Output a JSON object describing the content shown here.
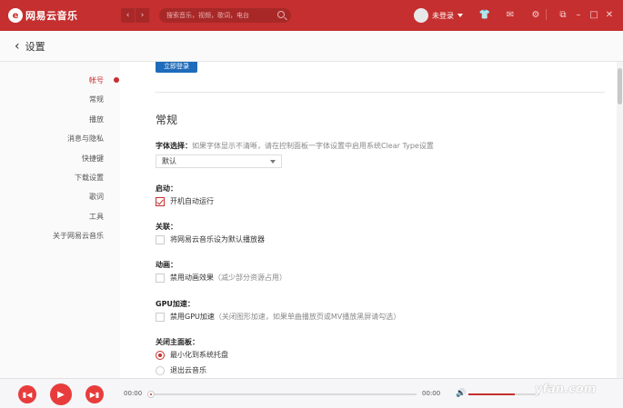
{
  "topbar": {
    "logo_mark": "e",
    "app_name": "网易云音乐",
    "nav_back": "‹",
    "nav_forward": "›",
    "search_placeholder": "搜索音乐，视频，歌词，电台",
    "login_status": "未登录",
    "icons": [
      "skin-icon",
      "mail-icon",
      "settings-icon",
      "mini-mode-icon",
      "minimize-icon",
      "maximize-icon",
      "close-icon"
    ]
  },
  "header": {
    "back": "‹",
    "title": "设置"
  },
  "sidebar": {
    "items": [
      {
        "label": "帐号",
        "active": true
      },
      {
        "label": "常规",
        "active": false
      },
      {
        "label": "播放",
        "active": false
      },
      {
        "label": "消息与隐私",
        "active": false
      },
      {
        "label": "快捷键",
        "active": false
      },
      {
        "label": "下载设置",
        "active": false
      },
      {
        "label": "歌词",
        "active": false
      },
      {
        "label": "工具",
        "active": false
      },
      {
        "label": "关于网易云音乐",
        "active": false
      }
    ]
  },
  "main": {
    "login_button": "立即登录",
    "section_title": "常规",
    "font": {
      "label": "字体选择：",
      "note": "如果字体显示不清晰，请在控制面板一字体设置中启用系统Clear Type设置",
      "value": "默认"
    },
    "startup": {
      "label": "启动：",
      "option": "开机自动运行",
      "checked": true
    },
    "association": {
      "label": "关联：",
      "option": "将网易云音乐设为默认播放器",
      "checked": false
    },
    "animation": {
      "label": "动画：",
      "option": "禁用动画效果",
      "note": "（减少部分资源占用）",
      "checked": false
    },
    "gpu": {
      "label": "GPU加速：",
      "option": "禁用GPU加速",
      "note": "（关闭图形加速，如果单曲播放页或MV播放黑屏请勾选）",
      "checked": false
    },
    "close_panel": {
      "label": "关闭主面板：",
      "options": [
        {
          "label": "最小化到系统托盘",
          "checked": true
        },
        {
          "label": "退出云音乐",
          "checked": false
        }
      ]
    }
  },
  "player": {
    "current_time": "00:00",
    "total_time": "00:00",
    "volume_level": 0.65,
    "watermark": "yfan.com"
  },
  "colors": {
    "brand_red": "#c62f2f",
    "login_blue": "#1e6bbc"
  }
}
